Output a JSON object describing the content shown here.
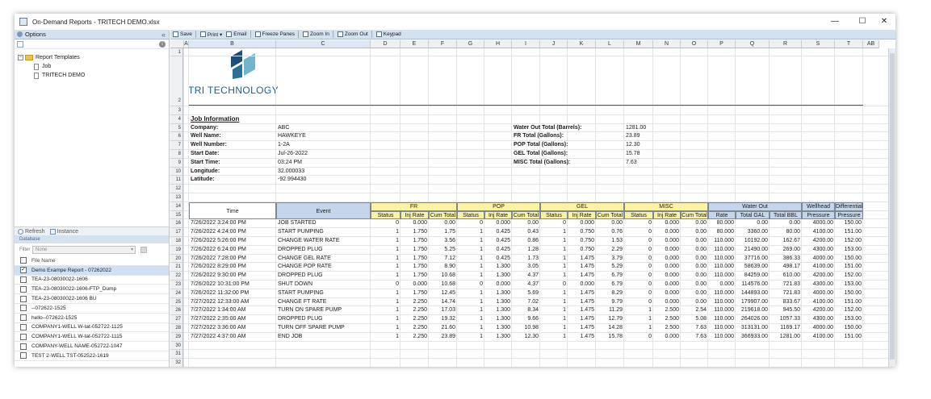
{
  "window": {
    "title": "On-Demand Reports - TRITECH DEMO.xlsx",
    "min": "—",
    "max": "☐",
    "close": "✕"
  },
  "left": {
    "options_label": "Options",
    "collapse_glyph": "«",
    "info_glyph": "i",
    "tree": {
      "root": "Report Templates",
      "root_exp": "−",
      "children": [
        "Job",
        "TRITECH DEMO"
      ]
    },
    "refresh_label": "Refresh",
    "instance_label": "Instance",
    "database_label": "Database",
    "filter_label": "Filter",
    "filter_value": "None",
    "filter_arrow": "▾",
    "file_header": "File Name",
    "checked_glyph": "✓",
    "files": [
      "Demo Exampe Report - 07262022",
      "TEA-23-08030022-1606",
      "TEA-23-08030022-1606-FTP_Dump",
      "TEA-23-08030022-1606 BU",
      "--072622-1525",
      "hello--072622-1525",
      "COMPANY1-WELL W-tat-052722-1125",
      "COMPANY1-WELL W-tat-052722-1115",
      "COMPANY-WELL NAME-052722-1047",
      "TEST 2-WELL TST-052522-1619"
    ],
    "selected_index": 0
  },
  "toolbar": {
    "save": "Save",
    "print": "Print ▾",
    "email": "Email",
    "freeze": "Freeze Panes",
    "zoom_in": "Zoom In",
    "zoom_out": "Zoom Out",
    "keypad": "Keypad"
  },
  "sheet": {
    "columns": [
      "A",
      "B",
      "C",
      "D",
      "E",
      "F",
      "G",
      "H",
      "I",
      "J",
      "K",
      "L",
      "M",
      "N",
      "O",
      "P",
      "Q",
      "R",
      "S",
      "T",
      "AB"
    ],
    "active_columns": [
      "B",
      "C"
    ],
    "rows": [
      "1",
      "2",
      "3",
      "4",
      "5",
      "6",
      "7",
      "8",
      "9",
      "10",
      "11",
      "12",
      "13",
      "14",
      "15",
      "16",
      "17",
      "18",
      "19",
      "20",
      "21",
      "22",
      "23",
      "24",
      "25",
      "26",
      "27",
      "28",
      "29",
      "30",
      "31",
      "32"
    ],
    "logo_text": "TRI TECHNOLOGY",
    "section_title": "Job Information",
    "info_labels": [
      "Company:",
      "Well Name:",
      "Well Number:",
      "Start Date:",
      "Start Time:",
      "Longitude:",
      "Latitude:"
    ],
    "info_values": [
      "ABC",
      "HAWKEYE",
      "1-2A",
      "Jul-26-2022",
      "03:24 PM",
      "32.000033",
      "-92.994430"
    ],
    "totals_labels": [
      "Water Out Total (Barrels):",
      "FR Total (Gallons):",
      "POP Total (Gallons):",
      "GEL Total (Gallons):",
      "MISC Total (Gallons):"
    ],
    "totals_values": [
      "1281.00",
      "23.89",
      "12.30",
      "15.78",
      "7.63"
    ],
    "headers": {
      "time": "Time",
      "event": "Event",
      "fr": "FR",
      "pop": "POP",
      "gel": "GEL",
      "misc": "MISC",
      "water": "Water Out",
      "wellhead": "Wellhead",
      "pressure": "Pressure",
      "differential": "Differential",
      "sub": [
        "Status",
        "Inj Rate",
        "Cum Total"
      ],
      "water_sub": [
        "Rate",
        "Total GAL",
        "Total BBL"
      ]
    },
    "data": [
      [
        "7/26/2022 3:24:00 PM",
        "JOB STARTED",
        "0",
        "0.000",
        "0.00",
        "0",
        "0.000",
        "0.00",
        "0",
        "0.000",
        "0.00",
        "0",
        "0.000",
        "0.00",
        "80.000",
        "0.00",
        "0.00",
        "4000.00",
        "150.00"
      ],
      [
        "7/26/2022 4:24:00 PM",
        "START PUMPING",
        "1",
        "1.750",
        "1.75",
        "1",
        "0.425",
        "0.43",
        "1",
        "0.750",
        "0.76",
        "0",
        "0.000",
        "0.00",
        "80.000",
        "3360.00",
        "80.00",
        "4100.00",
        "151.00"
      ],
      [
        "7/26/2022 5:26:00 PM",
        "CHANGE WATER RATE",
        "1",
        "1.750",
        "3.56",
        "1",
        "0.425",
        "0.86",
        "1",
        "0.750",
        "1.53",
        "0",
        "0.000",
        "0.00",
        "110.000",
        "10192.00",
        "162.67",
        "4200.00",
        "152.00"
      ],
      [
        "7/26/2022 6:24:00 PM",
        "DROPPED PLUG",
        "1",
        "1.750",
        "5.25",
        "1",
        "0.425",
        "1.28",
        "1",
        "0.750",
        "2.29",
        "0",
        "0.000",
        "0.00",
        "110.000",
        "21490.00",
        "269.00",
        "4300.00",
        "153.00"
      ],
      [
        "7/26/2022 7:28:00 PM",
        "CHANGE GEL RATE",
        "1",
        "1.750",
        "7.12",
        "1",
        "0.425",
        "1.73",
        "1",
        "1.475",
        "3.79",
        "0",
        "0.000",
        "0.00",
        "110.000",
        "37716.00",
        "386.33",
        "4000.00",
        "150.00"
      ],
      [
        "7/26/2022 8:29:00 PM",
        "CHANGE POP RATE",
        "1",
        "1.750",
        "8.90",
        "1",
        "1.300",
        "3.05",
        "1",
        "1.475",
        "5.29",
        "0",
        "0.000",
        "0.00",
        "110.000",
        "58639.00",
        "498.17",
        "4100.00",
        "151.00"
      ],
      [
        "7/26/2022 9:30:00 PM",
        "DROPPED PLUG",
        "1",
        "1.750",
        "10.68",
        "1",
        "1.300",
        "4.37",
        "1",
        "1.475",
        "6.79",
        "0",
        "0.000",
        "0.00",
        "110.000",
        "84259.00",
        "610.00",
        "4200.00",
        "152.00"
      ],
      [
        "7/26/2022 10:31:00 PM",
        "SHUT DOWN",
        "0",
        "0.000",
        "10.68",
        "0",
        "0.000",
        "4.37",
        "0",
        "0.000",
        "6.79",
        "0",
        "0.000",
        "0.00",
        "0.000",
        "114576.00",
        "721.83",
        "4300.00",
        "153.00"
      ],
      [
        "7/26/2022 11:32:00 PM",
        "START PUMPING",
        "1",
        "1.750",
        "12.45",
        "1",
        "1.300",
        "5.69",
        "1",
        "1.475",
        "8.29",
        "0",
        "0.000",
        "0.00",
        "110.000",
        "144893.00",
        "721.83",
        "4000.00",
        "150.00"
      ],
      [
        "7/27/2022 12:33:00 AM",
        "CHANGE FT RATE",
        "1",
        "2.250",
        "14.74",
        "1",
        "1.300",
        "7.02",
        "1",
        "1.475",
        "9.79",
        "0",
        "0.000",
        "0.00",
        "110.000",
        "179907.00",
        "833.67",
        "4100.00",
        "151.00"
      ],
      [
        "7/27/2022 1:34:00 AM",
        "TURN ON SPARE PUMP",
        "1",
        "2.250",
        "17.03",
        "1",
        "1.300",
        "8.34",
        "1",
        "1.475",
        "11.29",
        "1",
        "2.500",
        "2.54",
        "110.000",
        "219618.00",
        "945.50",
        "4200.00",
        "152.00"
      ],
      [
        "7/27/2022 2:35:00 AM",
        "DROPPED PLUG",
        "1",
        "2.250",
        "19.32",
        "1",
        "1.300",
        "9.66",
        "1",
        "1.475",
        "12.79",
        "1",
        "2.500",
        "5.08",
        "110.000",
        "264026.00",
        "1057.33",
        "4300.00",
        "153.00"
      ],
      [
        "7/27/2022 3:36:00 AM",
        "TURN OFF SPARE PUMP",
        "1",
        "2.250",
        "21.60",
        "1",
        "1.300",
        "10.98",
        "1",
        "1.475",
        "14.28",
        "1",
        "2.500",
        "7.63",
        "110.000",
        "313131.00",
        "1169.17",
        "4000.00",
        "150.00"
      ],
      [
        "7/27/2022 4:37:00 AM",
        "END JOB",
        "1",
        "2.250",
        "23.89",
        "1",
        "1.300",
        "12.30",
        "1",
        "1.475",
        "15.78",
        "0",
        "0.000",
        "7.63",
        "110.000",
        "366933.00",
        "1281.00",
        "4100.00",
        "151.00"
      ]
    ]
  }
}
